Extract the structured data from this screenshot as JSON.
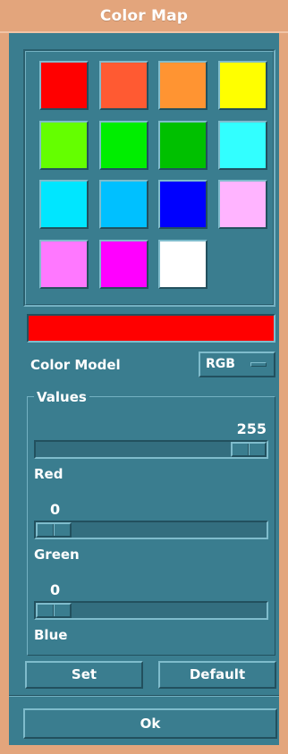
{
  "window": {
    "title": "Color Map"
  },
  "palette": {
    "swatches": [
      {
        "name": "red",
        "color": "#ff0000"
      },
      {
        "name": "orange-red",
        "color": "#ff5a32"
      },
      {
        "name": "orange",
        "color": "#ff9432"
      },
      {
        "name": "yellow",
        "color": "#ffff00"
      },
      {
        "name": "yellow-green",
        "color": "#64ff00"
      },
      {
        "name": "green",
        "color": "#00ee00"
      },
      {
        "name": "dark-green",
        "color": "#00c000"
      },
      {
        "name": "aqua",
        "color": "#32ffff"
      },
      {
        "name": "cyan",
        "color": "#00e6ff"
      },
      {
        "name": "sky-blue",
        "color": "#00c0ff"
      },
      {
        "name": "blue",
        "color": "#0000ff"
      },
      {
        "name": "light-pink",
        "color": "#ffb4ff"
      },
      {
        "name": "pink",
        "color": "#ff78ff"
      },
      {
        "name": "magenta",
        "color": "#ff00ff"
      },
      {
        "name": "white",
        "color": "#ffffff"
      }
    ],
    "current_color": "#ff0000"
  },
  "color_model": {
    "label": "Color Model",
    "value": "RGB"
  },
  "values": {
    "title": "Values",
    "red": {
      "label": "Red",
      "value": "255",
      "fraction": 1.0
    },
    "green": {
      "label": "Green",
      "value": "0",
      "fraction": 0.0
    },
    "blue": {
      "label": "Blue",
      "value": "0",
      "fraction": 0.0
    }
  },
  "buttons": {
    "set": "Set",
    "default": "Default",
    "ok": "Ok"
  }
}
